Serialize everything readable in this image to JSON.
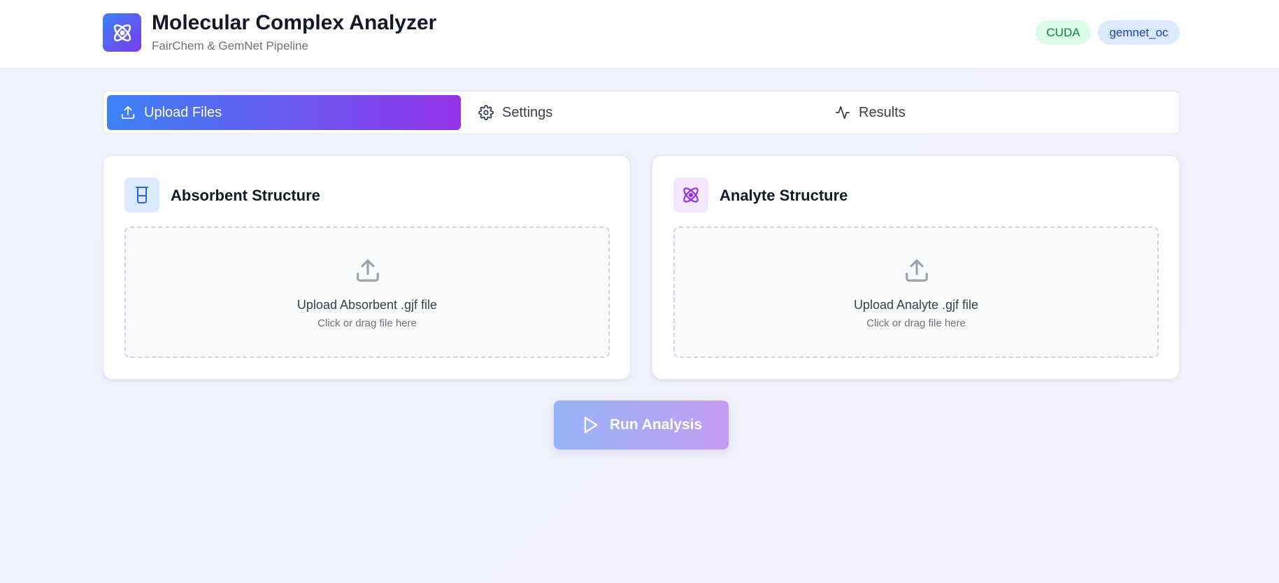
{
  "header": {
    "title": "Molecular Complex Analyzer",
    "subtitle": "FairChem & GemNet Pipeline",
    "logo_icon": "atom-icon",
    "badges": [
      "CUDA",
      "gemnet_oc"
    ]
  },
  "tabs": [
    {
      "label": "Upload Files",
      "icon": "upload-icon",
      "active": true
    },
    {
      "label": "Settings",
      "icon": "gear-icon",
      "active": false
    },
    {
      "label": "Results",
      "icon": "activity-icon",
      "active": false
    }
  ],
  "cards": [
    {
      "title": "Absorbent Structure",
      "icon": "beaker-icon",
      "upload_label": "Upload Absorbent .gjf file",
      "upload_hint": "Click or drag file here"
    },
    {
      "title": "Analyte Structure",
      "icon": "atom-icon",
      "upload_label": "Upload Analyte .gjf file",
      "upload_hint": "Click or drag file here"
    }
  ],
  "run_button": {
    "label": "Run Analysis",
    "icon": "play-icon"
  },
  "colors": {
    "accent_start": "#3b82f6",
    "accent_end": "#9333ea",
    "badge_green_bg": "#dcfce7",
    "badge_blue_bg": "#dbeafe"
  }
}
